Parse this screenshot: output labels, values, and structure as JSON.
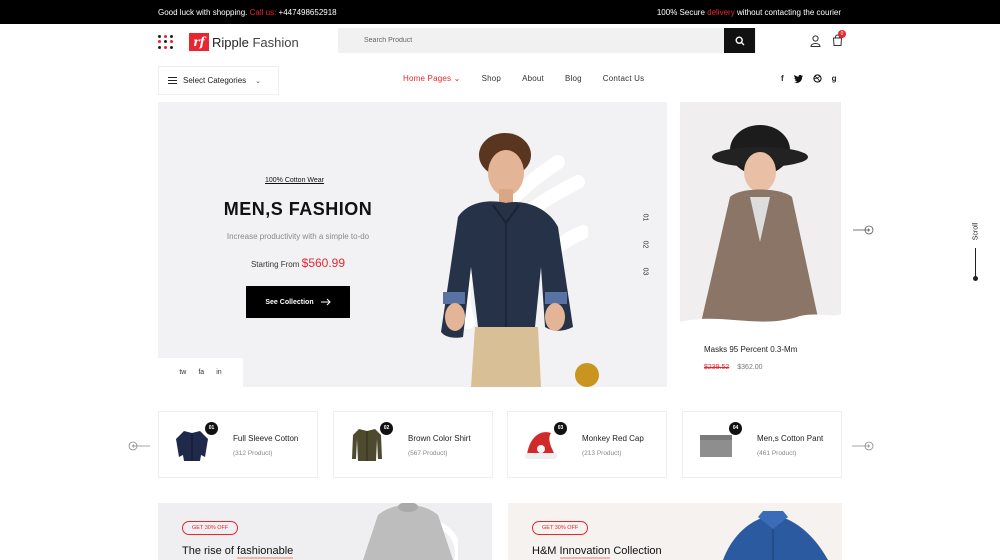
{
  "topbar": {
    "left_text": "Good luck with shopping.",
    "call_label": "Call us:",
    "phone": "+447498652918",
    "right_prefix": "100% Secure",
    "right_highlight": "delivery",
    "right_suffix": "without contacting the courier"
  },
  "header": {
    "logo_mark": "rf",
    "logo_name": "Ripple",
    "logo_suffix": "Fashion",
    "search_placeholder": "Search Product",
    "cart_count": "0"
  },
  "nav": {
    "categories_label": "Select Categories",
    "menu": [
      "Home Pages",
      "Shop",
      "About",
      "Blog",
      "Contact Us"
    ],
    "social": [
      "f",
      "t",
      "d",
      "g"
    ]
  },
  "hero": {
    "subtitle": "100% Cotton Wear",
    "title": "MEN,S FASHION",
    "description": "Increase productivity with a simple to-do",
    "price_prefix": "Starting From",
    "price": "$560.99",
    "button": "See Collection",
    "share": [
      "tw",
      "fa",
      "in"
    ],
    "slides": [
      "01",
      "02",
      "03"
    ]
  },
  "side_product": {
    "name": "Masks 95 Percent 0.3-Mm",
    "old_price": "$239.52",
    "price": "$362.00"
  },
  "scroll_label": "Scroll",
  "categories": [
    {
      "num": "01",
      "title": "Full Sleeve Cotton",
      "count": "(312 Product)"
    },
    {
      "num": "02",
      "title": "Brown Color Shirt",
      "count": "(567 Product)"
    },
    {
      "num": "03",
      "title": "Monkey Red Cap",
      "count": "(213 Product)"
    },
    {
      "num": "04",
      "title": "Men,s Cotton Pant",
      "count": "(461 Product)"
    }
  ],
  "promos": [
    {
      "tag": "GET 30% OFF",
      "title_plain": "The rise of ",
      "title_mark": "fashionable"
    },
    {
      "tag": "GET 30% OFF",
      "title_plain": "H&M ",
      "title_mark": "Innovation",
      "title_rest": " Collection"
    }
  ],
  "colors": {
    "accent": "#e8262f",
    "dark": "#000000",
    "hero_bg": "#f2f2f4"
  }
}
